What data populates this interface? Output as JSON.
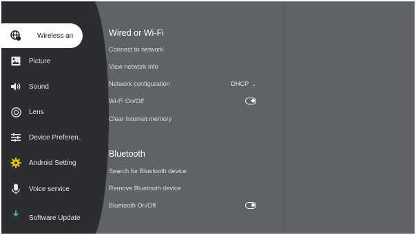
{
  "sidebar": {
    "items": [
      {
        "label": "Wireless an",
        "icon": "wifi-globe-icon",
        "active": true
      },
      {
        "label": "Picture",
        "icon": "picture-icon",
        "active": false
      },
      {
        "label": "Sound",
        "icon": "speaker-icon",
        "active": false
      },
      {
        "label": "Lens",
        "icon": "lens-icon",
        "active": false
      },
      {
        "label": "Device Preferen..",
        "icon": "device-settings-icon",
        "active": false
      },
      {
        "label": "Android Setting",
        "icon": "android-gear-icon",
        "active": false
      },
      {
        "label": "Voice service",
        "icon": "microphone-icon",
        "active": false
      },
      {
        "label": "Software Update",
        "icon": "download-icon",
        "active": false
      }
    ]
  },
  "wired": {
    "title": "Wired or Wi-Fi",
    "connect": "Connect to network",
    "view_info": "View network info",
    "config_label": "Network configuration",
    "config_value": "DHCP",
    "wifi_label": "Wi-Fi On/Off",
    "wifi_on": true,
    "clear_label": "Clear Internet memory"
  },
  "bluetooth": {
    "title": "Bluetooth",
    "search": "Search for Bluetooth device",
    "remove": "Remove Bluetooth device",
    "onoff_label": "Bluetooth On/Off",
    "bt_on": true
  }
}
